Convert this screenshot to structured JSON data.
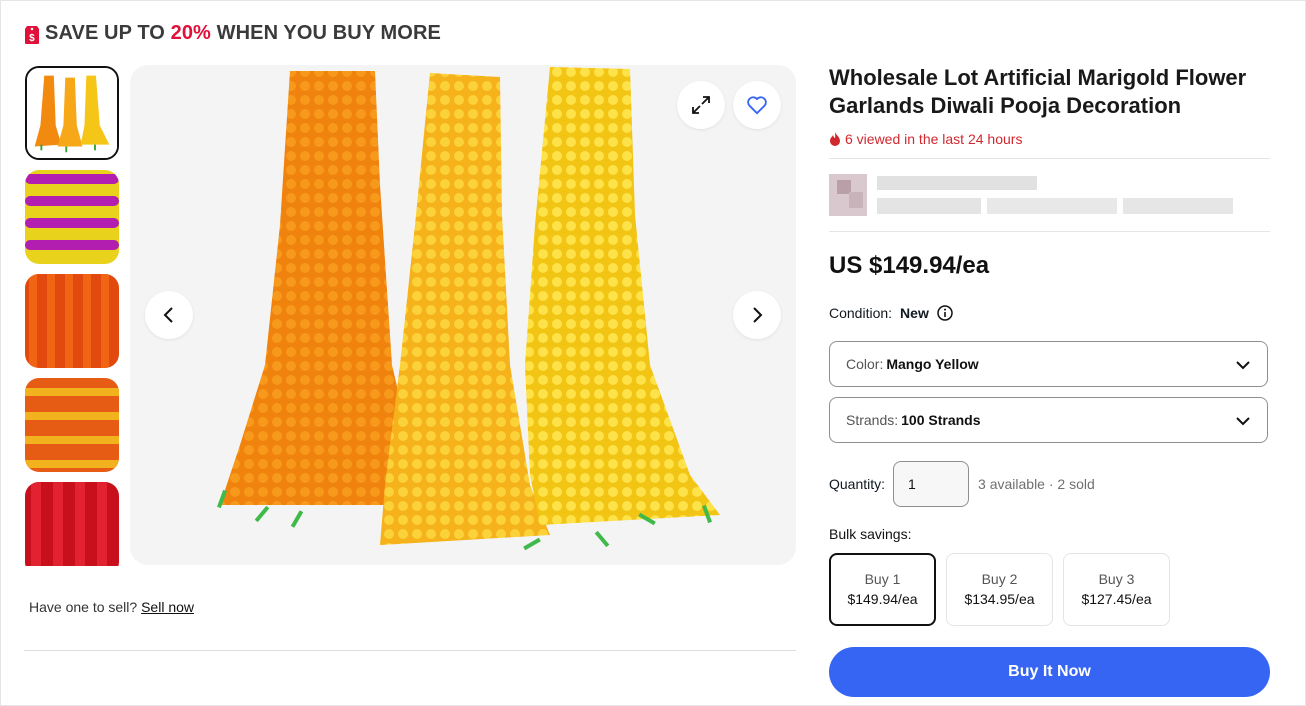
{
  "promo": {
    "prefix": "SAVE UP TO",
    "percent": "20%",
    "suffix": "WHEN YOU BUY MORE"
  },
  "gallery": {
    "thumbnails": [
      "orange-yellow-garlands",
      "purple-yellow-garlands",
      "orange-garlands",
      "orange-yellow-striped-garlands",
      "red-garlands"
    ],
    "selected_index": 0
  },
  "sell": {
    "prefix": "Have one to sell?",
    "link": "Sell now"
  },
  "listing": {
    "title": "Wholesale Lot Artificial Marigold Flower Garlands Diwali Pooja Decoration",
    "viewed": "6 viewed in the last 24 hours",
    "price": "US $149.94/ea",
    "condition_label": "Condition:",
    "condition_value": "New"
  },
  "options": {
    "color_label": "Color:",
    "color_value": "Mango Yellow",
    "strands_label": "Strands:",
    "strands_value": "100 Strands"
  },
  "quantity": {
    "label": "Quantity:",
    "value": "1",
    "availability": "3 available · 2 sold"
  },
  "bulk": {
    "label": "Bulk savings:",
    "tiers": [
      {
        "qty": "Buy 1",
        "price": "$149.94/ea"
      },
      {
        "qty": "Buy 2",
        "price": "$134.95/ea"
      },
      {
        "qty": "Buy 3",
        "price": "$127.45/ea"
      }
    ]
  },
  "buy_button": "Buy It Now",
  "colors": {
    "accent": "#3665f3",
    "promo_red": "#e0103a",
    "viewed_red": "#d0282f"
  }
}
